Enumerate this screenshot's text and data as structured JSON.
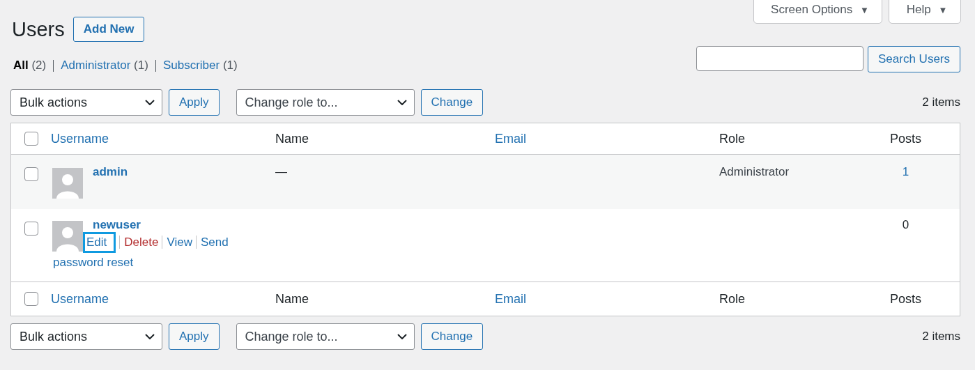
{
  "top_buttons": [
    {
      "label": "Screen Options",
      "caret": "▼"
    },
    {
      "label": "Help",
      "caret": "▼"
    }
  ],
  "title": "Users",
  "add_new": "Add New",
  "filters": [
    {
      "label": "All",
      "count": "(2)",
      "selected": true
    },
    {
      "label": "Administrator",
      "count": "(1)",
      "selected": false
    },
    {
      "label": "Subscriber",
      "count": "(1)",
      "selected": false
    }
  ],
  "search": {
    "button": "Search Users"
  },
  "top_nav": {
    "bulk": "Bulk actions",
    "apply": "Apply",
    "role": "Change role to...",
    "change": "Change",
    "count": "2 items"
  },
  "header": {
    "checked": false,
    "columns": [
      {
        "label": "Username",
        "sortable": true
      },
      {
        "label": "Name",
        "sortable": false
      },
      {
        "label": "Email",
        "sortable": true
      },
      {
        "label": "Role",
        "sortable": false
      },
      {
        "label": "Posts",
        "sortable": false
      }
    ]
  },
  "rows": [
    {
      "username": "admin",
      "name": "—",
      "role": "Administrator",
      "posts": "1",
      "posts_link": true,
      "checked": false,
      "actions": []
    },
    {
      "username": "newuser",
      "posts": "0",
      "posts_link": false,
      "checked": false,
      "actions": [
        {
          "label": "Edit",
          "kind": "link",
          "highlighted": true
        },
        {
          "label": "Delete",
          "kind": "danger",
          "highlighted": false
        },
        {
          "label": "View",
          "kind": "link",
          "highlighted": false
        },
        {
          "label": "Send",
          "kind": "link",
          "highlighted": false
        },
        {
          "label": "password reset",
          "kind": "continued",
          "highlighted": false
        }
      ]
    }
  ],
  "footer": {
    "checked": false,
    "columns": [
      {
        "label": "Username",
        "sortable": true
      },
      {
        "label": "Name",
        "sortable": false
      },
      {
        "label": "Email",
        "sortable": true
      },
      {
        "label": "Role",
        "sortable": false
      },
      {
        "label": "Posts",
        "sortable": false
      }
    ]
  },
  "bottom_nav": {
    "bulk": "Bulk actions",
    "apply": "Apply",
    "role": "Change role to...",
    "change": "Change",
    "count": "2 items"
  }
}
